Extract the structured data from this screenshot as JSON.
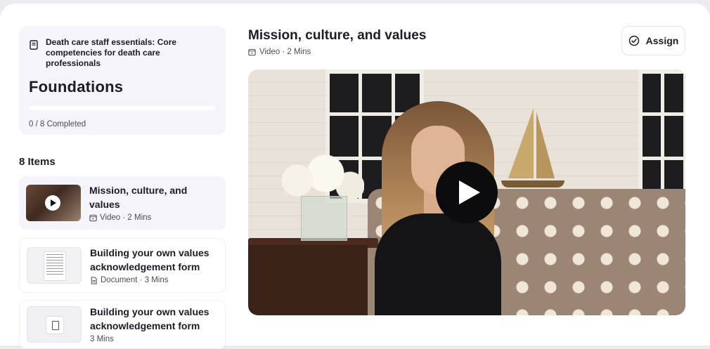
{
  "sidebar": {
    "course": {
      "icon": "book-icon",
      "name": "Death care staff essentials: Core competencies for death care professionals",
      "module_title": "Foundations",
      "progress_fraction": 0,
      "progress_text": "0 / 8 Completed"
    },
    "items_heading": "8 Items",
    "items": [
      {
        "title": "Mission, culture, and values",
        "type": "Video",
        "duration": "2 Mins",
        "meta": "Video · 2 Mins",
        "icon": "video-icon",
        "active": true
      },
      {
        "title": "Building your own values acknowledgement form",
        "type": "Document",
        "duration": "3 Mins",
        "meta": "Document · 3 Mins",
        "icon": "document-icon",
        "active": false
      },
      {
        "title": "Building your own values acknowledgement form",
        "type": "",
        "duration": "3 Mins",
        "meta": "3 Mins",
        "icon": "file-icon",
        "active": false
      }
    ]
  },
  "main": {
    "title": "Mission, culture, and values",
    "meta": "Video · 2 Mins",
    "assign_label": "Assign"
  },
  "colors": {
    "page_bg": "#ffffff",
    "card_bg": "#f5f4fa",
    "text": "#1c1c24",
    "muted": "#4b4b57"
  }
}
